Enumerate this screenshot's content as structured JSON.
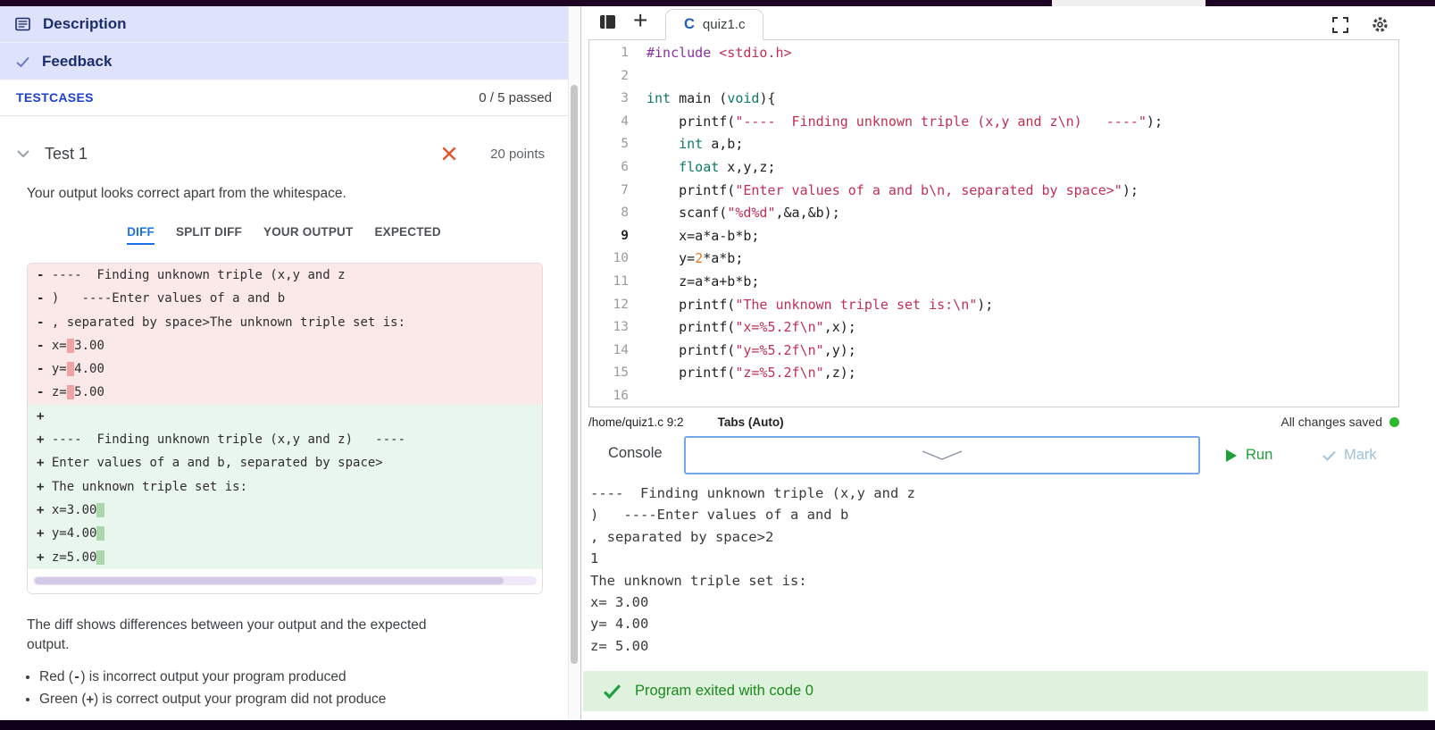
{
  "colors": {
    "header_bg": "#dfe2fb",
    "accent_blue": "#1a73e8",
    "testcases_blue": "#1b41cc",
    "fail_red": "#e4532c",
    "run_green": "#1ea13a",
    "success_green": "#1c8a1c",
    "diff_del_bg": "#fbe9e9",
    "diff_del_hl": "#f1a3a3",
    "diff_add_bg": "#e9f6ed",
    "diff_add_hl": "#a9d9aa"
  },
  "icons": {
    "add_tab": "+",
    "c_language": "C"
  },
  "left_panel": {
    "description_label": "Description",
    "feedback_label": "Feedback",
    "testcases_label": "TESTCASES",
    "passed_summary": "0 / 5 passed",
    "test_name": "Test 1",
    "test_points": "20 points",
    "message": "Your output looks correct apart from the whitespace.",
    "tabs": [
      {
        "label": "DIFF",
        "active": true
      },
      {
        "label": "SPLIT DIFF",
        "active": false
      },
      {
        "label": "YOUR OUTPUT",
        "active": false
      },
      {
        "label": "EXPECTED",
        "active": false
      }
    ],
    "diff": {
      "del_prefix": "-",
      "add_prefix": "+",
      "removed": [
        {
          "pre": "----  Finding unknown triple (x,y and z"
        },
        {
          "pre": ")   ----Enter values of a and b"
        },
        {
          "pre": ", separated by space>The unknown triple set is:"
        },
        {
          "pre": "x=",
          "hl": " ",
          "post": "3.00"
        },
        {
          "pre": "y=",
          "hl": " ",
          "post": "4.00"
        },
        {
          "pre": "z=",
          "hl": " ",
          "post": "5.00"
        }
      ],
      "added": [
        {
          "pre": ""
        },
        {
          "pre": "----  Finding unknown triple (x,y and z)   ----"
        },
        {
          "pre": "Enter values of a and b, separated by space>"
        },
        {
          "pre": "The unknown triple set is:"
        },
        {
          "pre": "x=3.00",
          "hl": " "
        },
        {
          "pre": "y=4.00",
          "hl": " "
        },
        {
          "pre": "z=5.00",
          "hl": " "
        }
      ]
    },
    "explanation": "The diff shows differences between your output and the expected output.",
    "legend": [
      {
        "pre": "Red (",
        "mark": "-",
        "post": ") is incorrect output your program produced"
      },
      {
        "pre": "Green (",
        "mark": "+",
        "post": ") is correct output your program did not produce"
      }
    ]
  },
  "editor": {
    "tab_label": "quiz1.c",
    "active_line": 9,
    "lines": [
      {
        "segs": [
          {
            "t": "#include",
            "c": "pp"
          },
          {
            "t": " "
          },
          {
            "t": "<stdio.h>",
            "c": "str"
          }
        ]
      },
      {
        "segs": []
      },
      {
        "segs": [
          {
            "t": "int",
            "c": "kw"
          },
          {
            "t": " main ("
          },
          {
            "t": "void",
            "c": "kw"
          },
          {
            "t": "){"
          }
        ]
      },
      {
        "segs": [
          {
            "t": "    printf("
          },
          {
            "t": "\"----  Finding unknown triple (x,y and z\\n)   ----\"",
            "c": "str"
          },
          {
            "t": ");"
          }
        ]
      },
      {
        "segs": [
          {
            "t": "    "
          },
          {
            "t": "int",
            "c": "kw"
          },
          {
            "t": " a,b;"
          }
        ]
      },
      {
        "segs": [
          {
            "t": "    "
          },
          {
            "t": "float",
            "c": "kw"
          },
          {
            "t": " x,y,z;"
          }
        ]
      },
      {
        "segs": [
          {
            "t": "    printf("
          },
          {
            "t": "\"Enter values of a and b\\n, separated by space>\"",
            "c": "str"
          },
          {
            "t": ");"
          }
        ]
      },
      {
        "segs": [
          {
            "t": "    scanf("
          },
          {
            "t": "\"%d%d\"",
            "c": "str"
          },
          {
            "t": ",&a,&b);"
          }
        ]
      },
      {
        "segs": [
          {
            "t": "    x=a*a-b*b;"
          }
        ]
      },
      {
        "segs": [
          {
            "t": "    y="
          },
          {
            "t": "2",
            "c": "num"
          },
          {
            "t": "*a*b;"
          }
        ]
      },
      {
        "segs": [
          {
            "t": "    z=a*a+b*b;"
          }
        ]
      },
      {
        "segs": [
          {
            "t": "    printf("
          },
          {
            "t": "\"The unknown triple set is:\\n\"",
            "c": "str"
          },
          {
            "t": ");"
          }
        ]
      },
      {
        "segs": [
          {
            "t": "    printf("
          },
          {
            "t": "\"x=%5.2f\\n\"",
            "c": "str"
          },
          {
            "t": ",x);"
          }
        ]
      },
      {
        "segs": [
          {
            "t": "    printf("
          },
          {
            "t": "\"y=%5.2f\\n\"",
            "c": "str"
          },
          {
            "t": ",y);"
          }
        ]
      },
      {
        "segs": [
          {
            "t": "    printf("
          },
          {
            "t": "\"z=%5.2f\\n\"",
            "c": "str"
          },
          {
            "t": ",z);"
          }
        ]
      },
      {
        "segs": []
      }
    ],
    "status": {
      "path": "/home/quiz1.c 9:2",
      "tabs_mode": "Tabs (Auto)",
      "saved": "All changes saved"
    }
  },
  "console": {
    "label": "Console",
    "run_label": "Run",
    "mark_label": "Mark",
    "output": [
      "----  Finding unknown triple (x,y and z",
      ")   ----Enter values of a and b",
      ", separated by space>2",
      "1",
      "The unknown triple set is:",
      "x= 3.00",
      "y= 4.00",
      "z= 5.00"
    ],
    "exit_message": "Program exited with code 0"
  }
}
